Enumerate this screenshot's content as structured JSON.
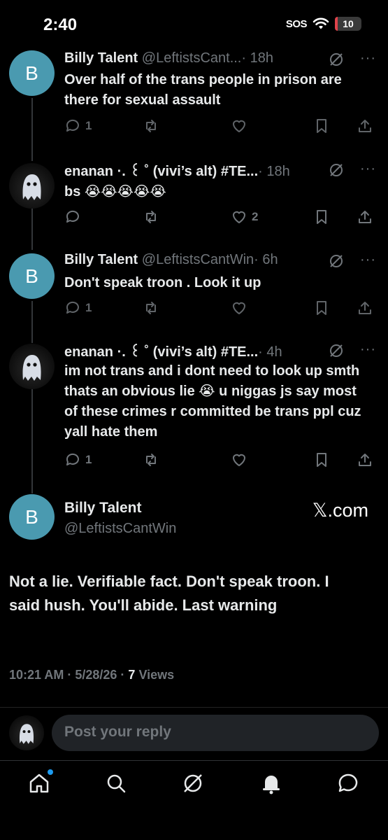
{
  "status_bar": {
    "time": "2:40",
    "sos": "SOS",
    "battery": "10",
    "battery_level_percent": 10
  },
  "thread": [
    {
      "name": "Billy Talent",
      "handle": "@LeftistsCant...",
      "time": "· 18h",
      "avatar_letter": "B",
      "text": "Over half of the trans people in prison are there for sexual assault",
      "replies": "1",
      "reposts": "",
      "likes": ""
    },
    {
      "name": "enanan ·. ꒰ ˚ (vivi’s alt) #TE...",
      "handle": "",
      "time": "· 18h",
      "avatar_letter": "",
      "text": "bs 😭😭😭😭😭",
      "replies": "",
      "reposts": "",
      "likes": "2"
    },
    {
      "name": "Billy Talent",
      "handle": "@LeftistsCantWin",
      "time": "· 6h",
      "avatar_letter": "B",
      "text": "Don't speak troon . Look it up",
      "replies": "1",
      "reposts": "",
      "likes": ""
    },
    {
      "name": "enanan ·. ꒰ ˚ (vivi’s alt) #TE...",
      "handle": "",
      "time": "· 4h",
      "avatar_letter": "",
      "text": "im not trans and i dont need to look up smth thats an obvious lie 😭 u niggas js say most of these crimes r committed be trans ppl cuz yall hate them",
      "replies": "1",
      "reposts": "",
      "likes": ""
    }
  ],
  "main_tweet": {
    "name": "Billy Talent",
    "handle": "@LeftistsCantWin",
    "avatar_letter": "B",
    "watermark": "𝕏.com",
    "text": "Not a lie. Verifiable fact. Don't speak troon. I said hush. You'll abide. Last warning",
    "timestamp": "10:21 AM · 5/28/26 · ",
    "views_count": "7",
    "views_label": " Views"
  },
  "reply_bar": {
    "placeholder": "Post your reply"
  },
  "colors": {
    "background": "#000000",
    "avatar_b": "#4a9ab0",
    "muted": "#71767b",
    "text": "#e7e9ea",
    "accent": "#1d9bf0"
  },
  "icons": {
    "reply": "reply-icon",
    "repost": "repost-icon",
    "like": "heart-icon",
    "bookmark": "bookmark-icon",
    "share": "share-icon",
    "grok": "grok-icon",
    "more": "more-icon",
    "home": "home-icon",
    "search": "search-icon",
    "notifications": "bell-icon",
    "messages": "messages-icon"
  }
}
